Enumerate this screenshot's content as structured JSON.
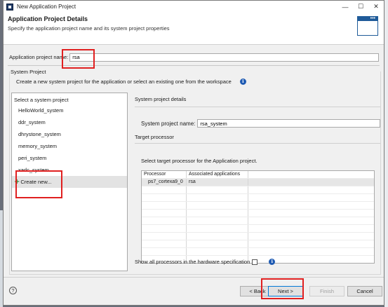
{
  "window": {
    "title": "New Application Project",
    "controls": {
      "minimize": "—",
      "maximize": "☐",
      "close": "✕"
    }
  },
  "header": {
    "title": "Application Project Details",
    "description": "Specify the application project name and its system project properties"
  },
  "project_name": {
    "label": "Application project name:",
    "value": "rsa"
  },
  "system_project": {
    "group_title": "System Project",
    "description": "Create a new system project for the application or select an existing one from the workspace",
    "list_header": "Select a system project",
    "items": [
      {
        "label": "HelloWorld_system"
      },
      {
        "label": "ddr_system"
      },
      {
        "label": "dhrystone_system"
      },
      {
        "label": "memory_system"
      },
      {
        "label": "peri_system"
      },
      {
        "label": "xadc_system"
      }
    ],
    "create_new": "Create new..."
  },
  "details": {
    "title": "System project details",
    "system_name_label": "System project name:",
    "system_name_value": "rsa_system",
    "target_title": "Target processor",
    "select_text": "Select target processor for the Application project.",
    "table": {
      "columns": [
        "Processor",
        "Associated applications"
      ],
      "rows": [
        {
          "processor": "ps7_cortexa9_0",
          "apps": "rsa",
          "selected": true
        }
      ]
    },
    "show_all_label": "Show all processors in the hardware specification",
    "show_all_checked": false
  },
  "footer": {
    "help": "?",
    "back": "< Back",
    "next": "Next >",
    "finish": "Finish",
    "cancel": "Cancel"
  },
  "colors": {
    "annotation_red": "#e02020",
    "accent_blue": "#1f5b99",
    "selection_gray": "#e3e3e3"
  }
}
